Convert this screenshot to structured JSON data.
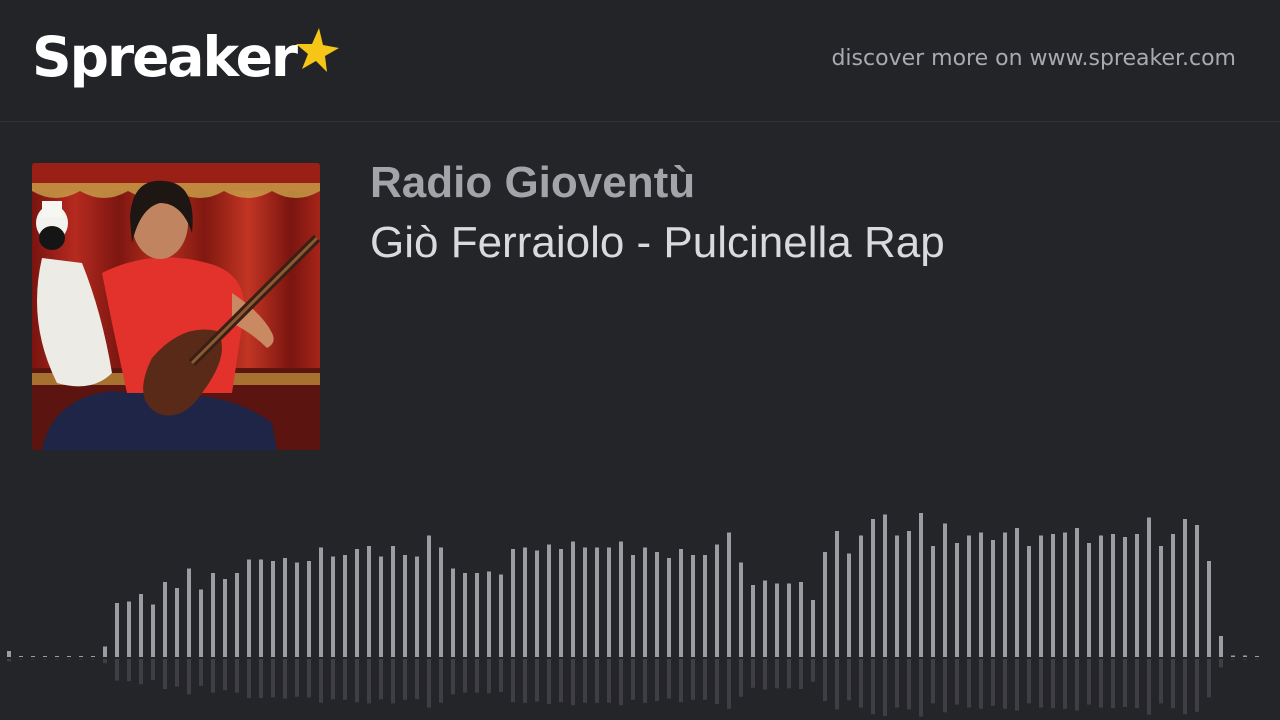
{
  "header": {
    "logo_text": "Spreaker",
    "discover_text": "discover more on www.spreaker.com"
  },
  "show": {
    "title": "Radio Gioventù"
  },
  "episode": {
    "title": "Giò Ferraiolo - Pulcinella Rap"
  },
  "colors": {
    "background": "#242529",
    "header": "#232428",
    "logo_text": "#ffffff",
    "logo_star": "#f5c518",
    "show_title": "#a3a4a9",
    "episode_title": "#d9dadd",
    "wave_bar": "#9c9da2"
  },
  "waveform": {
    "levels": [
      0.04,
      0,
      0,
      0,
      0,
      0,
      0,
      0,
      0.07,
      0.36,
      0.37,
      0.42,
      0.35,
      0.5,
      0.46,
      0.59,
      0.45,
      0.56,
      0.52,
      0.56,
      0.65,
      0.65,
      0.64,
      0.66,
      0.63,
      0.64,
      0.73,
      0.67,
      0.68,
      0.72,
      0.74,
      0.67,
      0.74,
      0.68,
      0.67,
      0.81,
      0.73,
      0.59,
      0.56,
      0.56,
      0.57,
      0.55,
      0.72,
      0.73,
      0.71,
      0.75,
      0.72,
      0.77,
      0.73,
      0.73,
      0.73,
      0.77,
      0.68,
      0.73,
      0.7,
      0.66,
      0.72,
      0.68,
      0.68,
      0.75,
      0.83,
      0.63,
      0.48,
      0.51,
      0.49,
      0.49,
      0.5,
      0.38,
      0.7,
      0.84,
      0.69,
      0.81,
      0.92,
      0.95,
      0.81,
      0.84,
      0.96,
      0.74,
      0.89,
      0.76,
      0.81,
      0.83,
      0.78,
      0.83,
      0.86,
      0.74,
      0.81,
      0.82,
      0.83,
      0.86,
      0.76,
      0.81,
      0.82,
      0.8,
      0.82,
      0.93,
      0.74,
      0.82,
      0.92,
      0.88,
      0.64,
      0.14,
      0.01,
      0.01,
      0
    ]
  }
}
